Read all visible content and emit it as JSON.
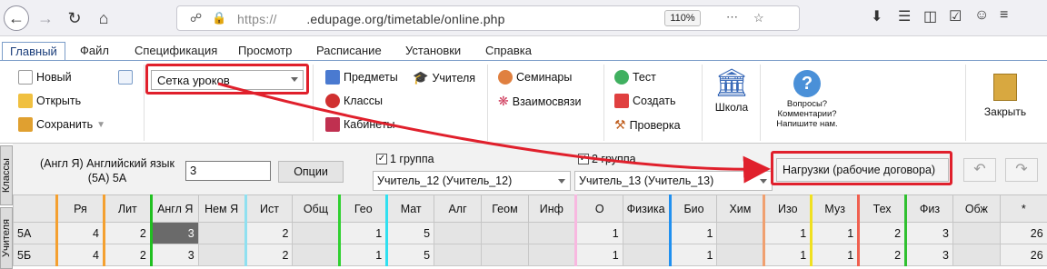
{
  "browser": {
    "url_prefix": "https://",
    "url_domain": ".edupage.org/timetable/online.php",
    "zoom": "110%"
  },
  "menu": {
    "tabs": [
      "Главный",
      "Файл",
      "Спецификация",
      "Просмотр",
      "Расписание",
      "Установки",
      "Справка"
    ]
  },
  "ribbon": {
    "new_label": "Новый",
    "open_label": "Открыть",
    "save_label": "Сохранить",
    "view_select": "Сетка уроков",
    "subjects_label": "Предметы",
    "teachers_label": "Учителя",
    "classes_label": "Классы",
    "rooms_label": "Кабинеты",
    "seminars_label": "Семинары",
    "relations_label": "Взаимосвязи",
    "test_label": "Тест",
    "create_label": "Создать",
    "check_label": "Проверка",
    "school_label": "Школа",
    "help_line1": "Вопросы?",
    "help_line2": "Комментарии?",
    "help_line3": "Напишите нам.",
    "close_label": "Закрыть"
  },
  "lesson": {
    "side_tab_classes": "Классы",
    "side_tab_teachers": "Учителя",
    "name_line1": "(Англ Я) Английский язык",
    "name_line2": "(5А) 5А",
    "count_value": "3",
    "options_label": "Опции",
    "group1_label": "1 группа",
    "group2_label": "2 группа",
    "teacher1": "Учитель_12 (Учитель_12)",
    "teacher2": "Учитель_13 (Учитель_13)",
    "load_label": "Нагрузки (рабочие договора)"
  },
  "grid": {
    "columns": [
      "Ря",
      "Лит",
      "Англ Я",
      "Нем Я",
      "Ист",
      "Общ",
      "Гео",
      "Мат",
      "Алг",
      "Геом",
      "Инф",
      "О",
      "Физика",
      "Био",
      "Хим",
      "Изо",
      "Муз",
      "Тех",
      "Физ",
      "Обж",
      "*"
    ],
    "colors": {
      "Ря": "#f4a030",
      "Лит": "#f4a030",
      "Англ Я": "#20c020",
      "Ист": "#90e0f0",
      "Гео": "#30d030",
      "Мат": "#30e0f0",
      "О": "#f8b8e0",
      "Био": "#2090f0",
      "Изо": "#f0a070",
      "Муз": "#f0e020",
      "Тех": "#f06050",
      "Физ": "#30c030"
    },
    "rows": [
      {
        "name": "5А",
        "values": [
          "4",
          "2",
          "3",
          "",
          "2",
          "",
          "1",
          "5",
          "",
          "",
          "",
          "1",
          "",
          "1",
          "",
          "1",
          "1",
          "2",
          "3",
          "",
          "26"
        ]
      },
      {
        "name": "5Б",
        "values": [
          "4",
          "2",
          "3",
          "",
          "2",
          "",
          "1",
          "5",
          "",
          "",
          "",
          "1",
          "",
          "1",
          "",
          "1",
          "1",
          "2",
          "3",
          "",
          "26"
        ]
      }
    ]
  }
}
